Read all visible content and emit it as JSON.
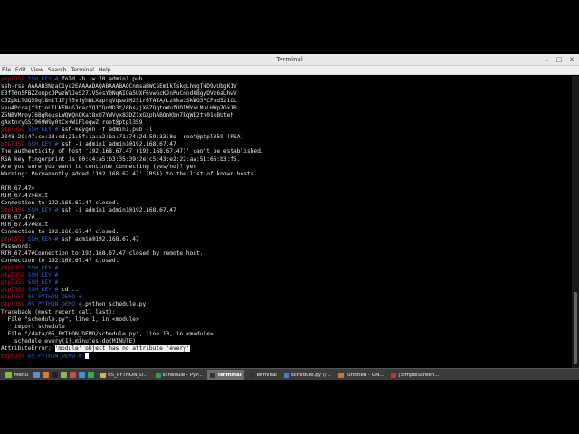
{
  "window": {
    "title": "Terminal",
    "controls": {
      "minimize": "–",
      "maximize": "□",
      "close": "✕"
    }
  },
  "menu": [
    "File",
    "Edit",
    "View",
    "Search",
    "Terminal",
    "Help"
  ],
  "terminal_lines": [
    {
      "host": "ptpl359",
      "path": "SSH_KEY",
      "cmd": "fold -b -w 70 admin1.pub"
    },
    {
      "text": "ssh-rsa AAAAB3NzaC1yc2EAAAADAQABAAABAQCnmsaBWCSEm1kTskgLhmgTND9vUbgK1V"
    },
    {
      "text": "E3fT0n5FBZZompcDPwzWlJeS27lV5osY0NqAIOa5UXF6vwGcKJnPuCnnd8BgyDVz6aLhwV"
    },
    {
      "text": "C6ZpkLlGQ59ql8nil1Tjl5vfyhNLXaprqVqswiM2Sir6TAIA/Lzkka1SkWG3PCFbd5z1OL"
    },
    {
      "text": "veu4Pcoajf3tioLILkFNuGJnacYQ1fQnMD3t/0hs/jX6ZQqtoWufUDlMYnLMuLHWp7Gx1B"
    },
    {
      "text": "Z5NBVMnoyI6BqReusLWQWQnOKat8xU7YWVyx83DZ1xGXphABOnKbn7kgWE2th01kBUteh"
    },
    {
      "text": "gAxtnryGSI969W9y0tCx+WiRleqwZ root@ptpl359"
    },
    {
      "host": "ptpl359",
      "path": "SSH_KEY",
      "cmd": "ssh-keygen -f admin1.pub -l"
    },
    {
      "text": "2048 29:47:ce:13:ed:21:5f:1a:a2:ba:71:74:2d:59:33:8e  root@ptpl359 (RSA)"
    },
    {
      "host": "ptpl359",
      "path": "SSH_KEY",
      "cmd": "ssh -i admin1 admin1@192.168.67.47"
    },
    {
      "text": "The authenticity of host '192.168.67.47 (192.168.67.47)' can't be established."
    },
    {
      "text": "RSA key fingerprint is 80:c4:a5:b3:35:39:2e:c5:43:e2:22:aa:51:66:b3:f5."
    },
    {
      "text": "Are you sure you want to continue connecting (yes/no)? yes"
    },
    {
      "text": "Warning: Permanently added '192.168.67.47' (RSA) to the list of known hosts."
    },
    {
      "text": ""
    },
    {
      "text": "RTR_67.47>"
    },
    {
      "text": "RTR_67.47>exit"
    },
    {
      "text": "Connection to 192.168.67.47 closed."
    },
    {
      "host": "ptpl359",
      "path": "SSH_KEY",
      "cmd": "ssh -i admin1 admin1@192.168.67.47"
    },
    {
      "text": "RTR_67.47#"
    },
    {
      "text": "RTR_67.47#exit"
    },
    {
      "text": "Connection to 192.168.67.47 closed."
    },
    {
      "host": "ptpl359",
      "path": "SSH_KEY",
      "cmd": "ssh admin@192.168.67.47"
    },
    {
      "text": "Password:"
    },
    {
      "text": "RTR_67.47#Connection to 192.168.67.47 closed by remote host."
    },
    {
      "text": "Connection to 192.168.67.47 closed."
    },
    {
      "host": "ptpl359",
      "path": "SSH_KEY",
      "cmd": ""
    },
    {
      "host": "ptpl359",
      "path": "SSH_KEY",
      "cmd": ""
    },
    {
      "host": "ptpl359",
      "path": "SSH_KEY",
      "cmd": ""
    },
    {
      "host": "ptpl359",
      "path": "SSH_KEY",
      "cmd": "cd .."
    },
    {
      "host": "ptpl359",
      "path": "05_PYTHON_DEMO",
      "cmd": ""
    },
    {
      "host": "ptpl359",
      "path": "05_PYTHON_DEMO",
      "cmd": "python schedule.py"
    },
    {
      "text": "Traceback (most recent call last):"
    },
    {
      "text": "  File \"schedule.py\", line 1, in <module>"
    },
    {
      "text": "    import schedule"
    },
    {
      "text": "  File \"/data/05_PYTHON_DEMO/schedule.py\", line 13, in <module>"
    },
    {
      "text": "    schedule.every(1).minutes.do(MINUTE)"
    },
    {
      "pre": "AttributeError: ",
      "sel": "'module' object has no attribute 'every'"
    },
    {
      "host": "ptpl359",
      "path": "05_PYTHON_DEMO",
      "cmd": "",
      "cursor": true
    }
  ],
  "taskbar": {
    "menu_label": "Menu",
    "tasks": [
      {
        "label": "05_PYTHON_D...",
        "color": "#d9b44a",
        "active": false
      },
      {
        "label": "schedule - PyP...",
        "color": "#2f9e4f",
        "active": false
      },
      {
        "label": "Terminal",
        "color": "#333333",
        "active": true
      },
      {
        "label": "Terminal",
        "color": "#333333",
        "active": false
      },
      {
        "label": "schedule.py (/...",
        "color": "#4a7bd1",
        "active": false
      },
      {
        "label": "[untitled - GN...",
        "color": "#c47a2c",
        "active": false
      },
      {
        "label": "[SimpleScreen...",
        "color": "#c0392b",
        "active": false
      }
    ],
    "quick_icons": [
      {
        "name": "desktop-icon",
        "color": "#5a8fd6"
      },
      {
        "name": "firefox-icon",
        "color": "#e8742a"
      },
      {
        "name": "terminal-icon",
        "color": "#222222"
      },
      {
        "name": "files-icon",
        "color": "#8fb35a"
      },
      {
        "name": "media-icon",
        "color": "#c84a4a"
      },
      {
        "name": "chrome-icon",
        "color": "#3e8ed9"
      },
      {
        "name": "pycharm-icon",
        "color": "#2fae5a"
      }
    ]
  }
}
